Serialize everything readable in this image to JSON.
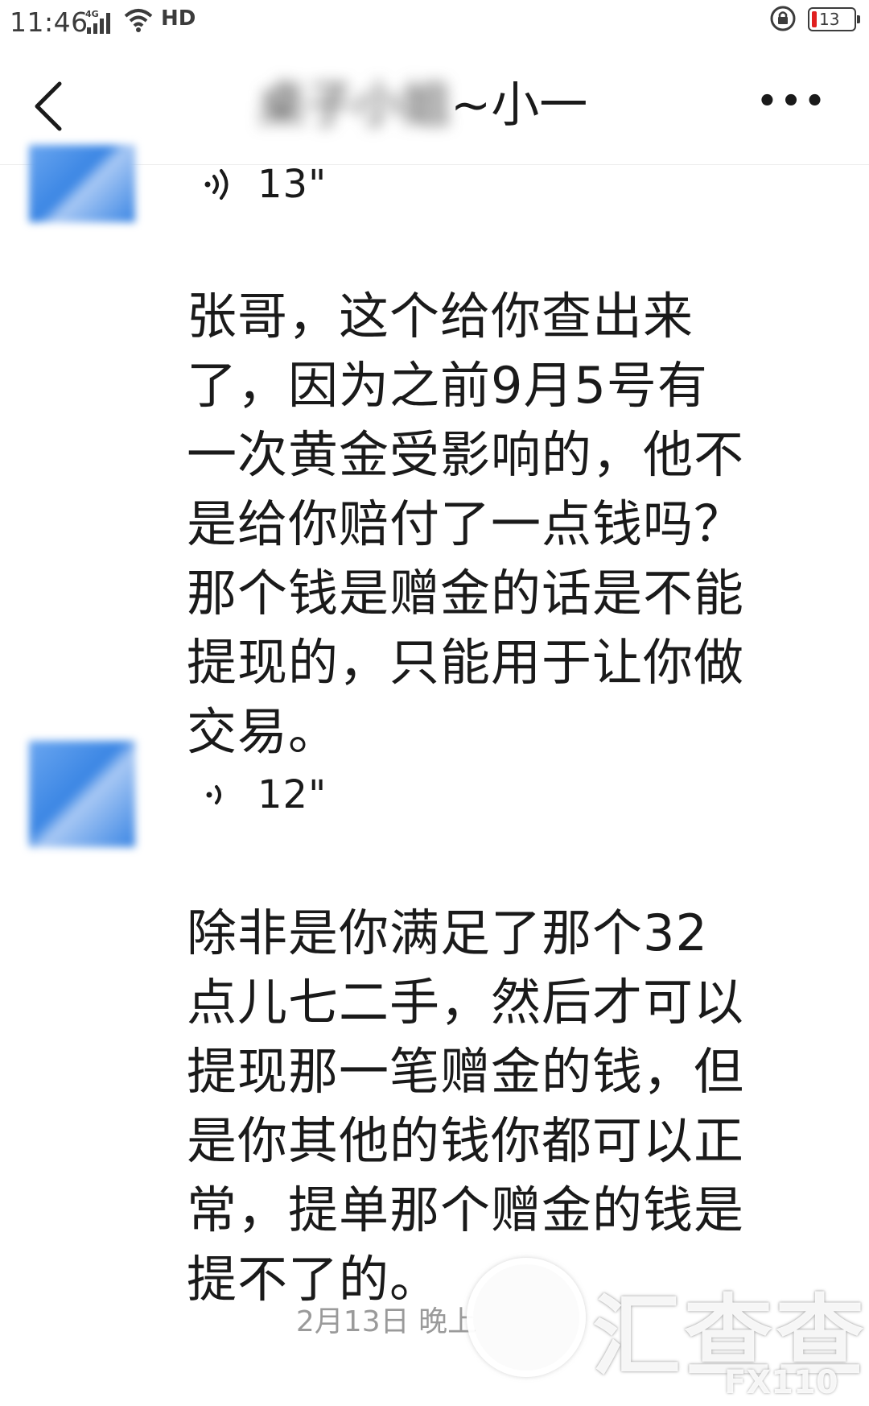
{
  "status_bar": {
    "time": "11:46",
    "network": "4G",
    "hd_label": "HD",
    "battery": "13"
  },
  "header": {
    "title_blurred": "桌子小姐",
    "title_suffix": "~小一",
    "back_icon": "chevron-left-icon",
    "more_label": "•••"
  },
  "messages": [
    {
      "voice_duration": "13\"",
      "transcript": "张哥，这个给你查出来了，因为之前9月5号有一次黄金受影响的，他不是给你赔付了一点钱吗？那个钱是赠金的话是不能提现的，只能用于让你做交易。"
    },
    {
      "voice_duration": "12\"",
      "transcript": "除非是你满足了那个32点儿七二手，然后才可以提现那一笔赠金的钱，但是你其他的钱你都可以正常，提单那个赠金的钱是提不了的。"
    }
  ],
  "timestamp": "2月13日 晚上",
  "watermark": {
    "brand": "汇查查",
    "site": "FX110网"
  },
  "colors": {
    "avatar_blue": "#3b86e4",
    "battery_low": "#e02020",
    "timestamp_gray": "#9a9a9a"
  }
}
